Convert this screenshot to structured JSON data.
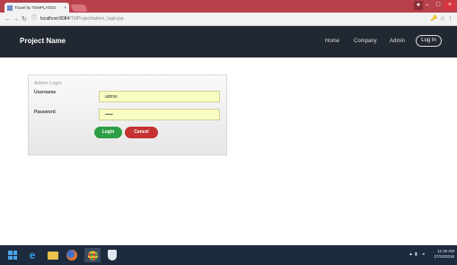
{
  "browser": {
    "tab_title": "Travel by TEMPLATED",
    "tab_close": "×",
    "url_host": "localhost:8084",
    "url_path": "/TMProject/admin_login.jsp"
  },
  "navbar": {
    "brand": "Project Name",
    "links": [
      "Home",
      "Company",
      "Admin"
    ],
    "login_button": "Log In"
  },
  "login_form": {
    "title": "Admin Login",
    "username_label": "Username",
    "username_value": "admin",
    "password_label": "Password",
    "password_value": "•••••",
    "login_button": "Login",
    "cancel_button": "Cancel"
  },
  "taskbar": {
    "time": "11:40 AM",
    "date": "27/10/2016"
  },
  "colors": {
    "navbar_bg": "#222831",
    "field_bg": "#fafdc2",
    "login_btn": "#2e9e45",
    "cancel_btn": "#c53232",
    "tabstrip": "#b8404a"
  }
}
